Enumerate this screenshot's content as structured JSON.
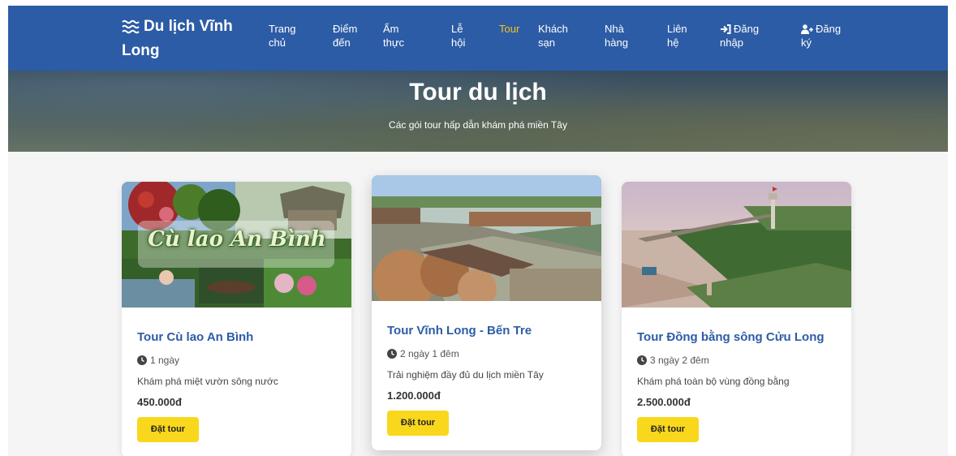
{
  "brand": {
    "line1": "Du lịch Vĩnh",
    "line2": "Long",
    "icon": "water-waves-icon"
  },
  "nav": [
    {
      "line1": "Trang",
      "line2": "chủ"
    },
    {
      "line1": "Điểm",
      "line2": "đến"
    },
    {
      "line1": "Ẩm",
      "line2": "thực"
    },
    {
      "line1": "Lễ",
      "line2": "hội"
    },
    {
      "line1": "Tour",
      "line2": "",
      "active": true
    },
    {
      "line1": "Khách",
      "line2": "sạn"
    },
    {
      "line1": "Nhà",
      "line2": "hàng"
    },
    {
      "line1": "Liên",
      "line2": "hệ"
    },
    {
      "line1": "Đăng",
      "line2": "nhập",
      "icon": "sign-in-icon"
    },
    {
      "line1": "Đăng",
      "line2": "ký",
      "icon": "user-plus-icon"
    }
  ],
  "hero": {
    "title": "Tour du lịch",
    "subtitle": "Các gói tour hấp dẫn khám phá miền Tây"
  },
  "tours": [
    {
      "image_text": "Cù lao An Bình",
      "title": "Tour Cù lao An Bình",
      "duration": "1 ngày",
      "description": "Khám phá miệt vườn sông nước",
      "price": "450.000đ",
      "button": "Đặt tour"
    },
    {
      "title": "Tour Vĩnh Long - Bến Tre",
      "duration": "2 ngày 1 đêm",
      "description": "Trải nghiệm đầy đủ du lịch miền Tây",
      "price": "1.200.000đ",
      "button": "Đặt tour"
    },
    {
      "title": "Tour Đồng bằng sông Cửu Long",
      "duration": "3 ngày 2 đêm",
      "description": "Khám phá toàn bộ vùng đồng bằng",
      "price": "2.500.000đ",
      "button": "Đặt tour"
    }
  ],
  "colors": {
    "navbar": "#2d5ca6",
    "active_nav": "#f5c518",
    "title_blue": "#2d5ca6",
    "button_yellow": "#f9d71c",
    "page_bg": "#f5f5f6"
  }
}
